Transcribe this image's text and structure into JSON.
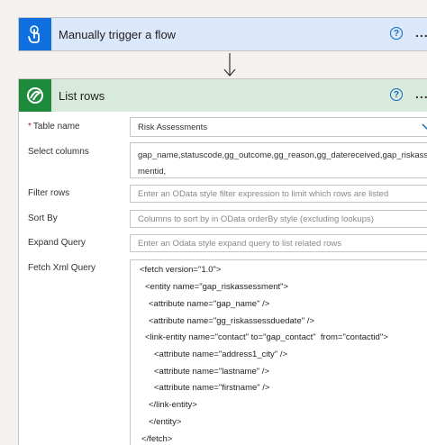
{
  "trigger": {
    "title": "Manually trigger a flow",
    "help": "?",
    "more": "..."
  },
  "action": {
    "title": "List rows",
    "help": "?",
    "more": "..."
  },
  "form": {
    "table_name": {
      "label": "Table name",
      "required_mark": "*",
      "value": "Risk Assessments"
    },
    "select_columns": {
      "label": "Select columns",
      "line1": "gap_name,statuscode,gg_outcome,gg_reason,gg_datereceived,gap_riskassess",
      "line2": "mentid,"
    },
    "filter_rows": {
      "label": "Filter rows",
      "placeholder": "Enter an OData style filter expression to limit which rows are listed"
    },
    "sort_by": {
      "label": "Sort By",
      "placeholder": "Columns to sort by in OData orderBy style (excluding lookups)"
    },
    "expand_query": {
      "label": "Expand Query",
      "placeholder": "Enter an Odata style expand query to list related rows"
    },
    "fetch_xml": {
      "label": "Fetch Xml Query",
      "lines": [
        "<fetch version=\"1.0\">",
        "<entity name=\"gap_riskassessment\">",
        "<attribute name=\"gap_name\" />",
        "<attribute name=\"gg_riskassessduedate\" />",
        "<link-entity name=\"contact\" to=\"gap_contact\"  from=\"contactid\">",
        "<attribute name=\"address1_city\" />",
        "<attribute name=\"lastname\" />",
        "<attribute name=\"firstname\" />",
        "</link-entity>",
        "</entity>",
        "</fetch>"
      ]
    }
  },
  "colors": {
    "trigger_header": "#dbe7fb",
    "trigger_icon": "#0f6fdf",
    "action_header": "#d8eadb",
    "action_icon": "#1e8a3c",
    "accent": "#0f6cbd"
  },
  "icons": {
    "trigger": "hand-touch-icon",
    "dataverse": "dataverse-icon",
    "help": "help-circle-icon",
    "more": "more-icon",
    "dropdown": "chevron-down-icon",
    "connector": "arrow-down-icon"
  }
}
